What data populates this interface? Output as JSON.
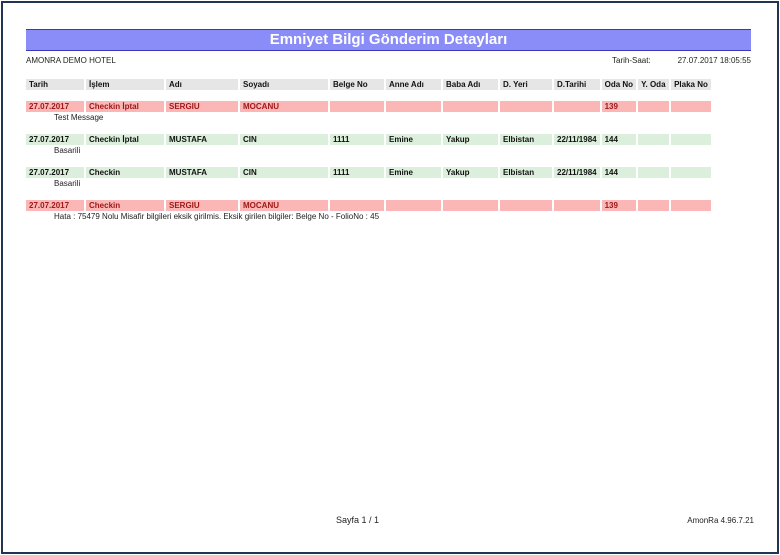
{
  "report": {
    "title": "Emniyet Bilgi Gönderim Detayları",
    "hotel": "AMONRA DEMO HOTEL",
    "datetime_label": "Tarih-Saat:",
    "datetime_value": "27.07.2017 18:05:55"
  },
  "table": {
    "headers": [
      "Tarih",
      "İşlem",
      "Adı",
      "Soyadı",
      "Belge No",
      "Anne Adı",
      "Baba Adı",
      "D. Yeri",
      "D.Tarihi",
      "Oda No",
      "Y. Oda",
      "Plaka No"
    ],
    "records": [
      {
        "status": "error",
        "cells": [
          "27.07.2017",
          "Checkin İptal",
          "SERGIU",
          "MOCANU",
          "",
          "",
          "",
          "",
          "",
          "139",
          "",
          ""
        ],
        "message": "Test Message"
      },
      {
        "status": "ok",
        "cells": [
          "27.07.2017",
          "Checkin İptal",
          "MUSTAFA",
          "CIN",
          "1111",
          "Emine",
          "Yakup",
          "Elbistan",
          "22/11/1984",
          "144",
          "",
          ""
        ],
        "message": "Basarili"
      },
      {
        "status": "ok",
        "cells": [
          "27.07.2017",
          "Checkin",
          "MUSTAFA",
          "CIN",
          "1111",
          "Emine",
          "Yakup",
          "Elbistan",
          "22/11/1984",
          "144",
          "",
          ""
        ],
        "message": "Basarili"
      },
      {
        "status": "error",
        "cells": [
          "27.07.2017",
          "Checkin",
          "SERGIU",
          "MOCANU",
          "",
          "",
          "",
          "",
          "",
          "139",
          "",
          ""
        ],
        "message": "Hata : 75479 Nolu Misafir bilgileri eksik girilmis. Eksik girilen bilgiler: Belge No - FolioNo : 45"
      }
    ]
  },
  "footer": {
    "page": "Sayfa 1 / 1",
    "version": "AmonRa 4.96.7.21"
  },
  "colors": {
    "title_bar": "#8a8cf8",
    "error_row": "#fbb6b6",
    "ok_row": "#dcefdc",
    "header_row": "#e6e6e6"
  }
}
